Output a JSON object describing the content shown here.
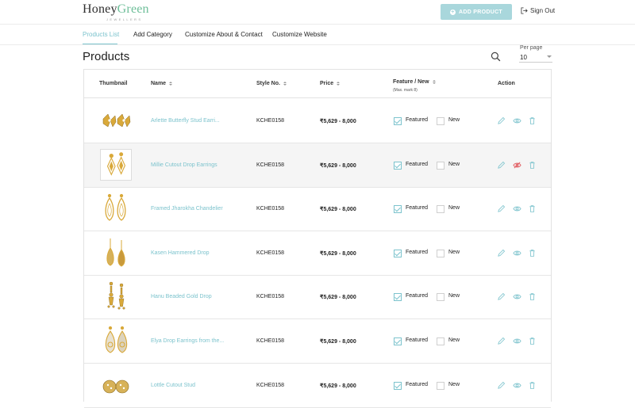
{
  "brand": {
    "name_part1": "Honey",
    "name_part2": "Green",
    "tagline": "JEWELLERS"
  },
  "header": {
    "add_label": "ADD PRODUCT",
    "signout_label": "Sign Out"
  },
  "tabs": [
    {
      "label": "Products List",
      "active": true
    },
    {
      "label": "Add Category",
      "active": false
    },
    {
      "label": "Customize About & Contact",
      "active": false
    },
    {
      "label": "Customize Website",
      "active": false
    }
  ],
  "page": {
    "title": "Products",
    "per_page_label": "Per page",
    "per_page_value": "10"
  },
  "table": {
    "headers": {
      "thumbnail": "Thumbnail",
      "name": "Name",
      "style": "Style No.",
      "price": "Price",
      "feature": "Feature / New",
      "feature_sub": "(Max. mark 8)",
      "action": "Action"
    },
    "featured_label": "Featured",
    "new_label": "New",
    "rows": [
      {
        "name": "Arlette Butterfly Stud Earri...",
        "style": "KCHE0158",
        "price": "₹5,629 - 8,000",
        "featured": true,
        "new": false,
        "hidden": false
      },
      {
        "name": "Millie Cutout Drop Earrings",
        "style": "KCHE0158",
        "price": "₹5,629 - 8,000",
        "featured": true,
        "new": false,
        "hidden": true
      },
      {
        "name": "Framed Jharokha Chandelier",
        "style": "KCHE0158",
        "price": "₹5,629 - 8,000",
        "featured": true,
        "new": false,
        "hidden": false
      },
      {
        "name": "Kasen Hammered Drop",
        "style": "KCHE0158",
        "price": "₹5,629 - 8,000",
        "featured": true,
        "new": false,
        "hidden": false
      },
      {
        "name": "Hanu Beaded Gold Drop",
        "style": "KCHE0158",
        "price": "₹5,629 - 8,000",
        "featured": true,
        "new": false,
        "hidden": false
      },
      {
        "name": "Elya Drop Earrings from the...",
        "style": "KCHE0158",
        "price": "₹5,629 - 8,000",
        "featured": true,
        "new": false,
        "hidden": false
      },
      {
        "name": "Lottle Cutout Stud",
        "style": "KCHE0158",
        "price": "₹5,629 - 8,000",
        "featured": true,
        "new": false,
        "hidden": false
      }
    ]
  },
  "colors": {
    "accent": "#7cc3cd",
    "button": "#a9d7dc",
    "danger": "#e0555a",
    "brand_green": "#6fbf9a",
    "gold": "#d9a93a"
  },
  "icons": [
    "plus-icon",
    "sign-out-icon",
    "search-icon",
    "sort-icon",
    "edit-icon",
    "view-icon",
    "hidden-icon",
    "delete-icon",
    "earring-thumbnail"
  ]
}
